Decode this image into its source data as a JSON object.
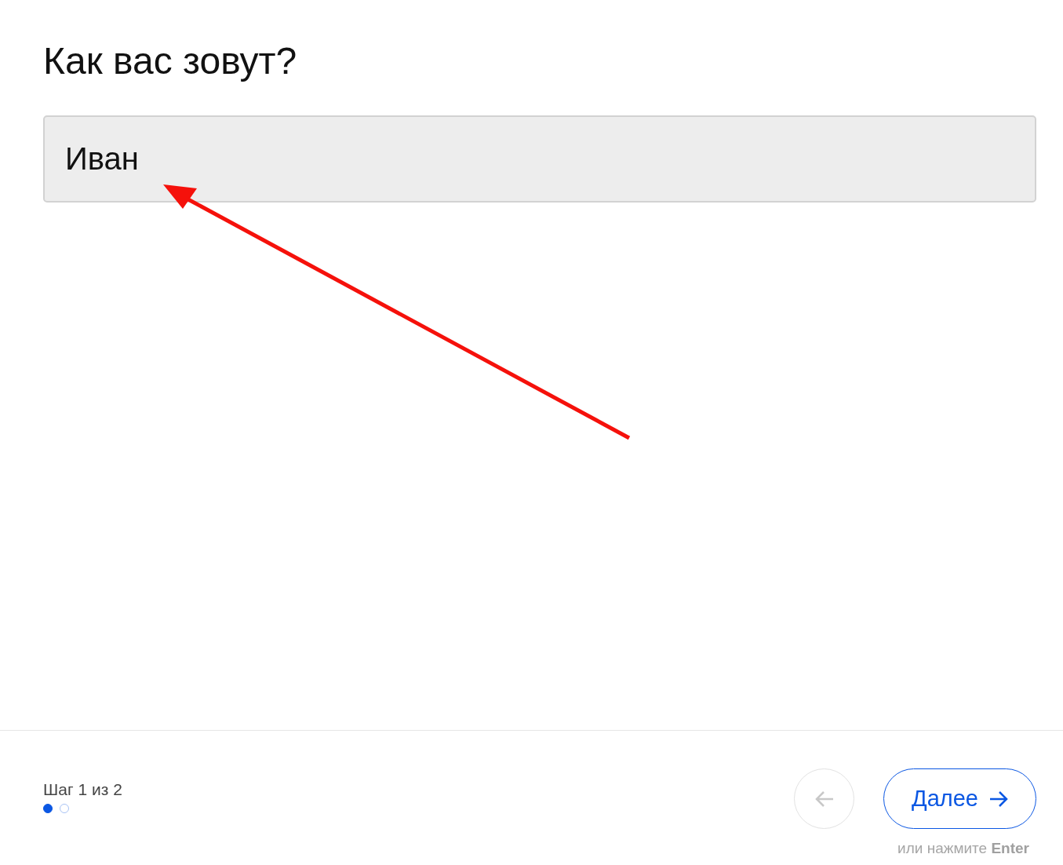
{
  "question": {
    "title": "Как вас зовут?",
    "answer": "Иван"
  },
  "footer": {
    "step_label": "Шаг 1 из 2",
    "steps": [
      {
        "selected": true
      },
      {
        "selected": false
      }
    ],
    "back_button": {
      "disabled": true
    },
    "next_button": {
      "label": "Далее"
    },
    "hint": "или нажмите **Enter**"
  }
}
